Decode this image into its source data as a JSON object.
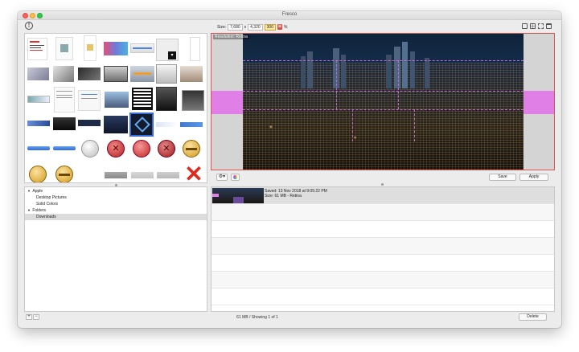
{
  "window": {
    "title": "Fresco"
  },
  "toolbar": {
    "size_label": "Size:",
    "width": "7,680",
    "times": "x",
    "height": "4,320",
    "scale": "300",
    "percent": "%"
  },
  "preview": {
    "resolution_label": "Resolution: Retina"
  },
  "actions": {
    "save": "Save",
    "apply": "Apply"
  },
  "tree": {
    "items": [
      {
        "label": "Apple",
        "expander": "▼"
      },
      {
        "label": "Desktop Pictures"
      },
      {
        "label": "Solid Colors"
      },
      {
        "label": "Folders",
        "expander": "▼"
      },
      {
        "label": "Downloads"
      }
    ]
  },
  "list": {
    "entry": {
      "saved": "Saved: 13 Nov 2018 at 9:05:22 PM",
      "size": "Size: 61 MB - Retina"
    }
  },
  "footer": {
    "add": "+",
    "remove": "−",
    "status": "61 MB / Showing 1 of 1",
    "delete": "Delete"
  },
  "colors": {
    "accent_red": "#d9534f",
    "guide_magenta": "#e080e6",
    "lock_red": "#d94a3a"
  }
}
